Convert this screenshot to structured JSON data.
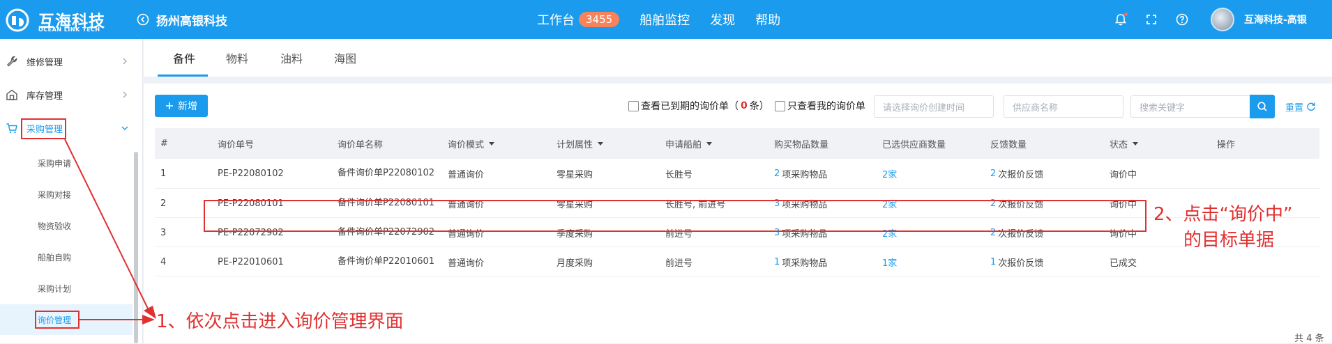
{
  "header": {
    "logo_cn": "互海科技",
    "logo_en": "OCEAN LINK TECH",
    "company": "扬州高银科技",
    "nav": [
      {
        "label": "工作台",
        "badge": "3455"
      },
      {
        "label": "船舶监控"
      },
      {
        "label": "发现"
      },
      {
        "label": "帮助"
      }
    ],
    "user_name": "互海科技-高银"
  },
  "sidebar": {
    "groups": [
      {
        "label": "维修管理",
        "icon": "wrench-icon"
      },
      {
        "label": "库存管理",
        "icon": "warehouse-icon"
      },
      {
        "label": "采购管理",
        "icon": "cart-icon"
      }
    ],
    "sub_items": [
      "采购申请",
      "采购对接",
      "物资验收",
      "船舶自购",
      "采购计划",
      "询价管理"
    ]
  },
  "tabs": [
    "备件",
    "物料",
    "油料",
    "海图"
  ],
  "toolbar": {
    "new_button": "新增",
    "expired_prefix": "查看已到期的询价单（",
    "expired_count": "0",
    "expired_suffix": "条）",
    "mine_only": "只查看我的询价单",
    "date_placeholder": "请选择询价创建时间",
    "supplier_placeholder": "供应商名称",
    "keyword_placeholder": "搜索关键字",
    "reset": "重置"
  },
  "table": {
    "columns": [
      "#",
      "询价单号",
      "询价单名称",
      "询价模式",
      "计划属性",
      "申请船舶",
      "购买物品数量",
      "已选供应商数量",
      "反馈数量",
      "状态",
      "操作"
    ],
    "rows": [
      {
        "idx": "1",
        "no": "PE-P22080102",
        "name": "备件询价单P22080102",
        "mode": "普通询价",
        "plan": "零星采购",
        "ship": "长胜号",
        "items_n": "2",
        "items_t": "项采购物品",
        "suppliers": "2家",
        "fb_n": "2",
        "fb_t": "次报价反馈",
        "status": "询价中"
      },
      {
        "idx": "2",
        "no": "PE-P22080101",
        "name": "备件询价单P22080101",
        "mode": "普通询价",
        "plan": "零星采购",
        "ship": "长胜号, 前进号",
        "items_n": "3",
        "items_t": "项采购物品",
        "suppliers": "2家",
        "fb_n": "2",
        "fb_t": "次报价反馈",
        "status": "询价中"
      },
      {
        "idx": "3",
        "no": "PE-P22072902",
        "name": "备件询价单P22072902",
        "mode": "普通询价",
        "plan": "季度采购",
        "ship": "前进号",
        "items_n": "3",
        "items_t": "项采购物品",
        "suppliers": "2家",
        "fb_n": "2",
        "fb_t": "次报价反馈",
        "status": "询价中"
      },
      {
        "idx": "4",
        "no": "PE-P22010601",
        "name": "备件询价单P22010601",
        "mode": "普通询价",
        "plan": "月度采购",
        "ship": "前进号",
        "items_n": "1",
        "items_t": "项采购物品",
        "suppliers": "1家",
        "fb_n": "1",
        "fb_t": "次报价反馈",
        "status": "已成交"
      }
    ],
    "total": "共 4 条"
  },
  "annotations": {
    "step1": "1、依次点击进入询价管理界面",
    "step2_line1": "2、点击“询价中”",
    "step2_line2": "的目标单据"
  },
  "colors": {
    "primary": "#1a9bed",
    "annotation": "#e03131",
    "badge": "#f7835b"
  }
}
